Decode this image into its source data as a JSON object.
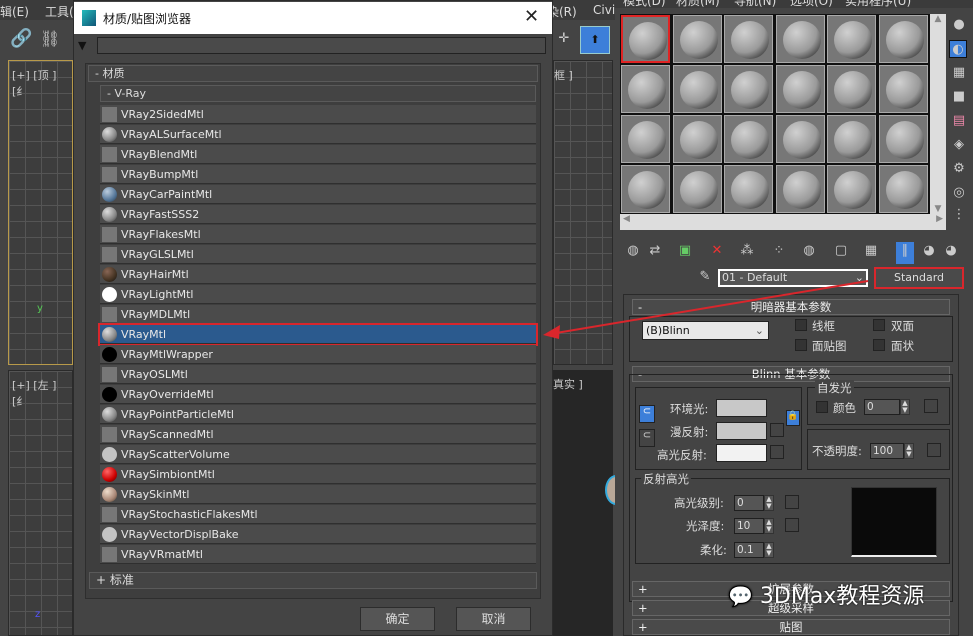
{
  "menubar": {
    "left_items": [
      "辑(E)",
      "工具("
    ],
    "right_left_items": [
      "染(R)",
      "Civi"
    ],
    "material_editor_menu": [
      "模式(D)",
      "材质(M)",
      "导航(N)",
      "选项(O)",
      "实用程序(U)"
    ]
  },
  "viewports": {
    "top_label": "[+] [顶 ] [纟",
    "top_right_label": "框 ]",
    "left_label": "[+] [左 ] [纟",
    "persp_label": "真实 ]",
    "axis_y": "y",
    "axis_z": "z"
  },
  "dialog": {
    "title": "材质/贴图浏览器",
    "search_value": "",
    "category": "- 材质",
    "group": "- V-Ray",
    "items": [
      {
        "label": "VRay2SidedMtl",
        "icon": "flat"
      },
      {
        "label": "VRayALSurfaceMtl",
        "icon": "sphere-gray"
      },
      {
        "label": "VRayBlendMtl",
        "icon": "flat"
      },
      {
        "label": "VRayBumpMtl",
        "icon": "flat"
      },
      {
        "label": "VRayCarPaintMtl",
        "icon": "sphere-blue"
      },
      {
        "label": "VRayFastSSS2",
        "icon": "sphere-gray"
      },
      {
        "label": "VRayFlakesMtl",
        "icon": "flat"
      },
      {
        "label": "VRayGLSLMtl",
        "icon": "flat"
      },
      {
        "label": "VRayHairMtl",
        "icon": "sphere-brown"
      },
      {
        "label": "VRayLightMtl",
        "icon": "sphere-white"
      },
      {
        "label": "VRayMDLMtl",
        "icon": "flat"
      },
      {
        "label": "VRayMtl",
        "icon": "sphere-gray",
        "selected": true
      },
      {
        "label": "VRayMtlWrapper",
        "icon": "sphere-black"
      },
      {
        "label": "VRayOSLMtl",
        "icon": "flat"
      },
      {
        "label": "VRayOverrideMtl",
        "icon": "sphere-black"
      },
      {
        "label": "VRayPointParticleMtl",
        "icon": "sphere-gray"
      },
      {
        "label": "VRayScannedMtl",
        "icon": "flat"
      },
      {
        "label": "VRayScatterVolume",
        "icon": "sphere-light"
      },
      {
        "label": "VRaySimbiontMtl",
        "icon": "sphere-red"
      },
      {
        "label": "VRaySkinMtl",
        "icon": "sphere-skin"
      },
      {
        "label": "VRayStochasticFlakesMtl",
        "icon": "flat"
      },
      {
        "label": "VRayVectorDisplBake",
        "icon": "sphere-light"
      },
      {
        "label": "VRayVRmatMtl",
        "icon": "flat"
      }
    ],
    "standard_group": "+ 标准",
    "ok_label": "确定",
    "cancel_label": "取消"
  },
  "material_editor": {
    "material_name": "01 - Default",
    "material_type": "Standard",
    "shader_rollout": {
      "title": "明暗器基本参数",
      "shader": "(B)Blinn",
      "wire": "线框",
      "two_sided": "双面",
      "face_map": "面贴图",
      "faceted": "面状"
    },
    "blinn_rollout": {
      "title": "Blinn 基本参数",
      "ambient": "环境光:",
      "diffuse": "漫反射:",
      "specular": "高光反射:",
      "self_illum_title": "自发光",
      "self_illum_color": "颜色",
      "self_illum_value": "0",
      "opacity_label": "不透明度:",
      "opacity_value": "100",
      "spec_title": "反射高光",
      "spec_level_label": "高光级别:",
      "spec_level": "0",
      "gloss_label": "光泽度:",
      "gloss": "10",
      "soften_label": "柔化:",
      "soften": "0.1"
    },
    "collapsed_rollouts": [
      "扩展参数",
      "超级采样",
      "贴图"
    ]
  },
  "watermark": "3DMax教程资源",
  "colors": {
    "highlight": "#d9262c",
    "selection": "#2b5a8e"
  }
}
